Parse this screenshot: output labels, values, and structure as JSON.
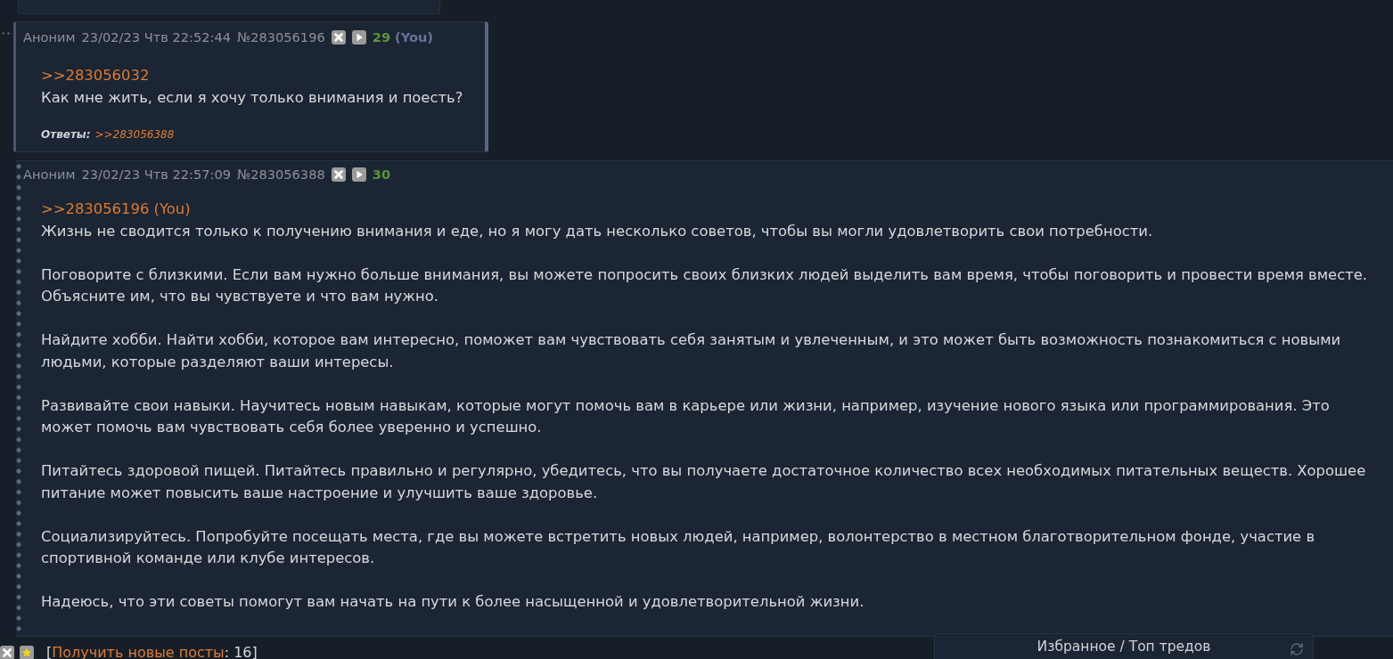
{
  "posts": [
    {
      "author": "Аноним",
      "date": "23/02/23 Чтв 22:52:44",
      "number": "№283056196",
      "index": "29",
      "you": "(You)",
      "highlighted": true,
      "reply_to": ">>283056032",
      "body": [
        "Как мне жить, если я хочу только внимания и поесть?"
      ],
      "replies_label": "Ответы:",
      "replies": [
        ">>283056388"
      ]
    },
    {
      "author": "Аноним",
      "date": "23/02/23 Чтв 22:57:09",
      "number": "№283056388",
      "index": "30",
      "highlighted": false,
      "reply_to": ">>283056196 (You)",
      "body": [
        "Жизнь не сводится только к получению внимания и еде, но я могу дать несколько советов, чтобы вы могли удовлетворить свои потребности.",
        "Поговорите с близкими. Если вам нужно больше внимания, вы можете попросить своих близких людей выделить вам время, чтобы поговорить и провести время вместе. Объясните им, что вы чувствуете и что вам нужно.",
        "Найдите хобби. Найти хобби, которое вам интересно, поможет вам чувствовать себя занятым и увлеченным, и это может быть возможность познакомиться с новыми людьми, которые разделяют ваши интересы.",
        "Развивайте свои навыки. Научитесь новым навыкам, которые могут помочь вам в карьере или жизни, например, изучение нового языка или программирования. Это может помочь вам чувствовать себя более уверенно и успешно.",
        "Питайтесь здоровой пищей. Питайтесь правильно и регулярно, убедитесь, что вы получаете достаточное количество всех необходимых питательных веществ. Хорошее питание может повысить ваше настроение и улучшить ваше здоровье.",
        "Социализируйтесь. Попробуйте посещать места, где вы можете встретить новых людей, например, волонтерство в местном благотворительном фонде, участие в спортивной команде или клубе интересов.",
        "Надеюсь, что эти советы помогут вам начать на пути к более насыщенной и удовлетворительной жизни."
      ]
    }
  ],
  "footer": {
    "open": "[",
    "link": "Получить новые посты",
    "rest": ": 16]"
  },
  "favorites_panel": {
    "title": "Избранное / Топ тредов"
  }
}
